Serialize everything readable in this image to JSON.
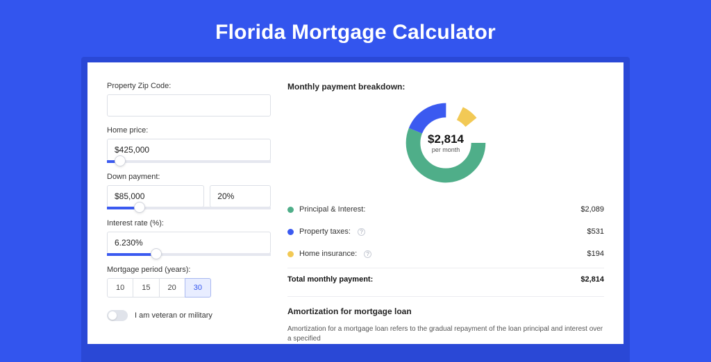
{
  "title": "Florida Mortgage Calculator",
  "form": {
    "zip_label": "Property Zip Code:",
    "zip_value": "",
    "home_price_label": "Home price:",
    "home_price_value": "$425,000",
    "home_price_slider_pct": 8,
    "down_payment_label": "Down payment:",
    "down_payment_value": "$85,000",
    "down_payment_pct_value": "20%",
    "down_payment_slider_pct": 20,
    "interest_label": "Interest rate (%):",
    "interest_value": "6.230%",
    "interest_slider_pct": 30,
    "period_label": "Mortgage period (years):",
    "period_options": [
      "10",
      "15",
      "20",
      "30"
    ],
    "period_active_index": 3,
    "veteran_label": "I am veteran or military",
    "veteran_on": false
  },
  "breakdown": {
    "heading": "Monthly payment breakdown:",
    "total_amount": "$2,814",
    "per_month": "per month",
    "items": [
      {
        "label": "Principal & Interest:",
        "value": "$2,089",
        "color": "#4fae89",
        "pct": 74,
        "help": false
      },
      {
        "label": "Property taxes:",
        "value": "$531",
        "color": "#3b5af0",
        "pct": 19,
        "help": true
      },
      {
        "label": "Home insurance:",
        "value": "$194",
        "color": "#f2c955",
        "pct": 7,
        "help": true
      }
    ],
    "total_label": "Total monthly payment:",
    "total_value": "$2,814"
  },
  "amortization": {
    "heading": "Amortization for mortgage loan",
    "text": "Amortization for a mortgage loan refers to the gradual repayment of the loan principal and interest over a specified"
  },
  "chart_data": {
    "type": "pie",
    "title": "Monthly payment breakdown",
    "series": [
      {
        "name": "Principal & Interest",
        "value": 2089,
        "pct": 74,
        "color": "#4fae89"
      },
      {
        "name": "Property taxes",
        "value": 531,
        "pct": 19,
        "color": "#3b5af0"
      },
      {
        "name": "Home insurance",
        "value": 194,
        "pct": 7,
        "color": "#f2c955"
      }
    ],
    "total": 2814,
    "center_label": "$2,814 per month"
  }
}
